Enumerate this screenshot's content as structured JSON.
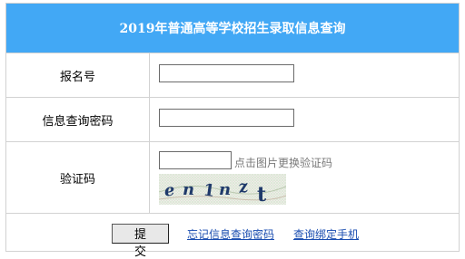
{
  "title": "2019年普通高等学校招生录取信息查询",
  "fields": {
    "exam_number_label": "报名号",
    "exam_number_value": "",
    "password_label": "信息查询密码",
    "password_value": "",
    "captcha_label": "验证码",
    "captcha_value": "",
    "captcha_hint": "点击图片更换验证码",
    "captcha_image_text": "en1nzt"
  },
  "actions": {
    "submit_label": "提 交",
    "forgot_password_link": "忘记信息查询密码",
    "bind_phone_link": "查询绑定手机"
  },
  "colors": {
    "header_bg": "#42a8f5",
    "header_text": "#ffffff",
    "link": "#1a4db0",
    "border": "#d2d2d2"
  }
}
